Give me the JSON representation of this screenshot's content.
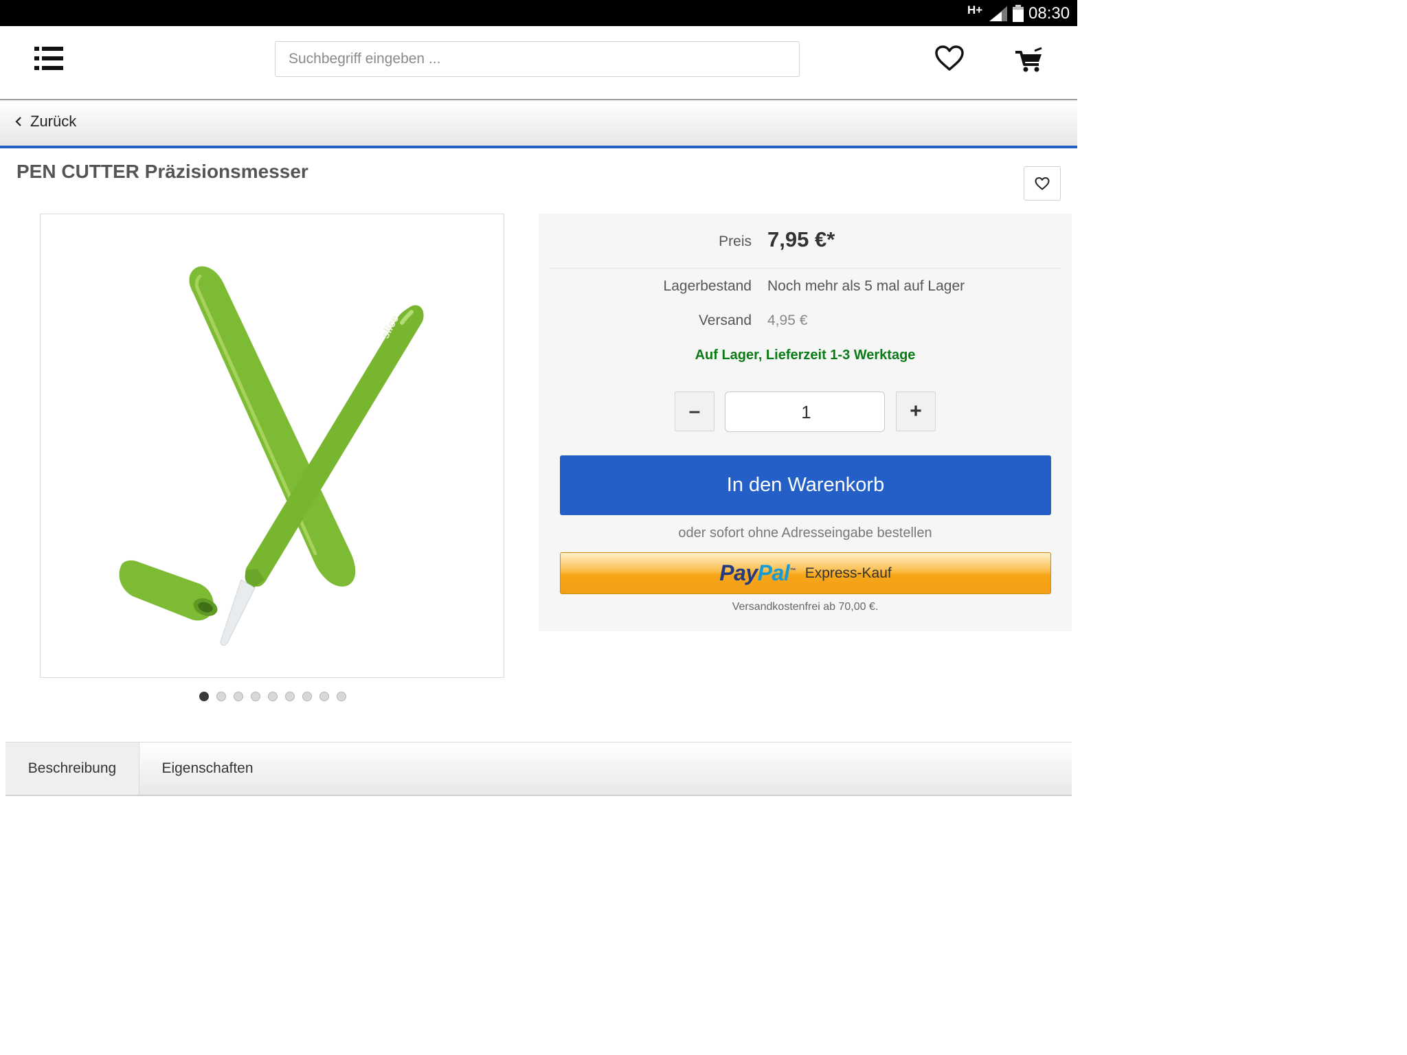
{
  "status_bar": {
    "network": "H+",
    "time": "08:30"
  },
  "header": {
    "search_placeholder": "Suchbegriff eingeben ..."
  },
  "nav": {
    "back_label": "Zurück"
  },
  "product": {
    "title": "PEN CUTTER Präzisionsmesser",
    "image_count": 9,
    "active_image": 1,
    "image_alt_brand": "slice",
    "image_colors": {
      "body": "#7dbb34",
      "highlight": "#a6d35c",
      "blade": "#e8ecef"
    }
  },
  "buy_box": {
    "price_label": "Preis",
    "price_value": "7,95 €*",
    "stock_label": "Lagerbestand",
    "stock_value": "Noch mehr als 5 mal auf Lager",
    "shipping_label": "Versand",
    "shipping_value": "4,95 €",
    "availability": "Auf Lager, Lieferzeit 1-3 Werktage",
    "quantity_minus": "–",
    "quantity": "1",
    "quantity_plus": "+",
    "add_to_cart": "In den Warenkorb",
    "alternative_text": "oder sofort ohne Adresseingabe bestellen",
    "paypal_pay": "Pay",
    "paypal_pal": "Pal",
    "paypal_tm": "™",
    "paypal_express": "Express-Kauf",
    "free_shipping_note": "Versandkostenfrei ab 70,00 €."
  },
  "tabs": [
    {
      "label": "Beschreibung",
      "active": true
    },
    {
      "label": "Eigenschaften",
      "active": false
    }
  ],
  "colors": {
    "accent_blue": "#235fc6",
    "availability_green": "#0a7a14",
    "paypal_orange": "#f7a618"
  }
}
